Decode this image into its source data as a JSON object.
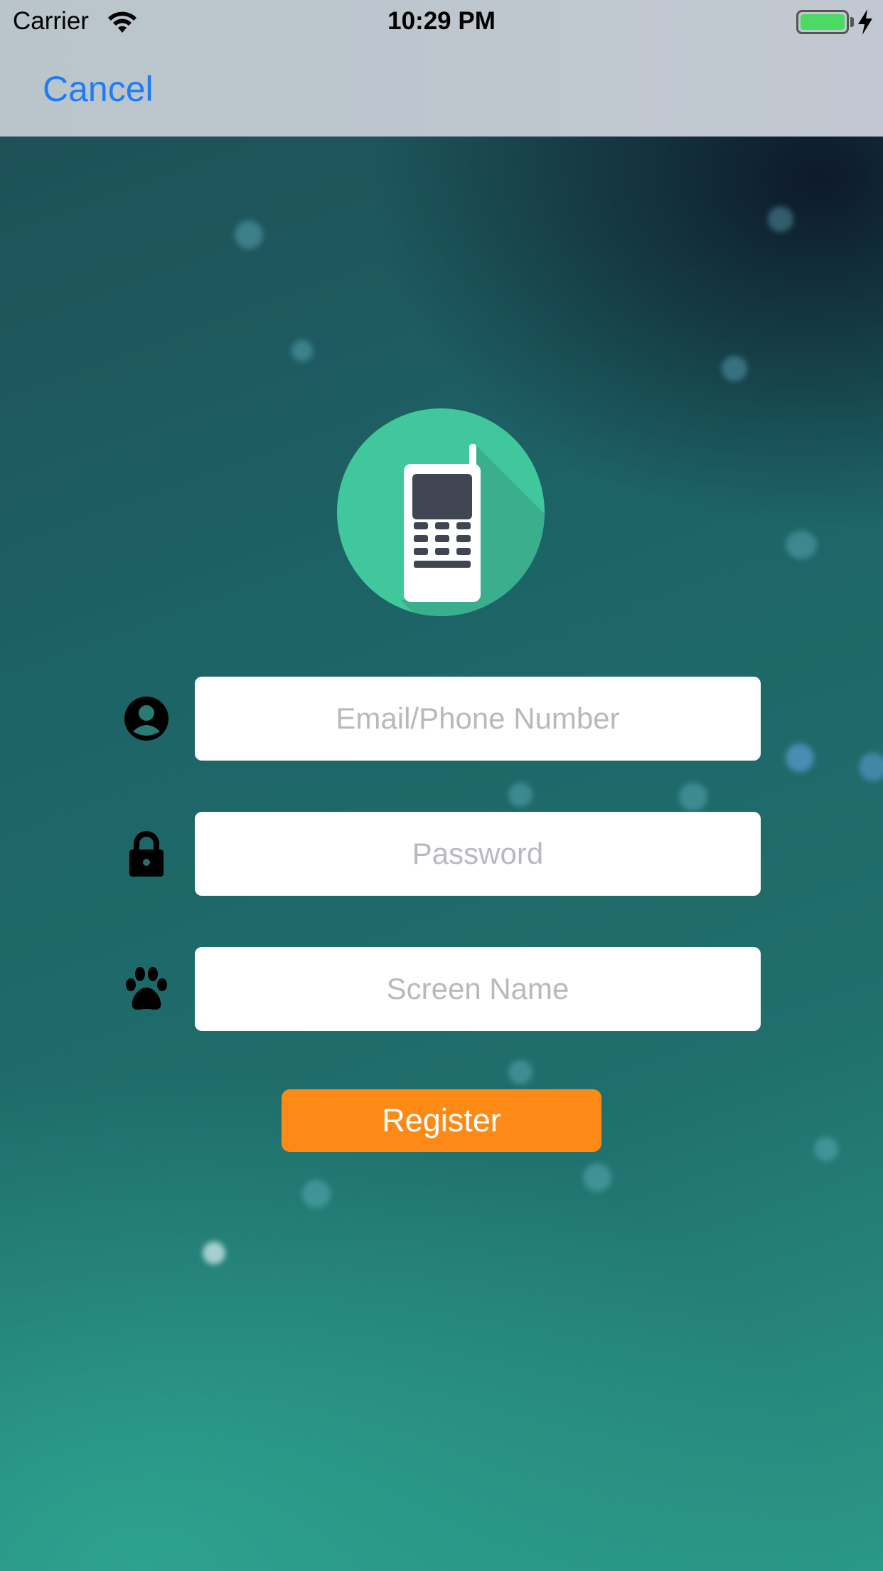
{
  "status_bar": {
    "carrier": "Carrier",
    "time": "10:29 PM",
    "battery_color": "#4cd964"
  },
  "nav": {
    "cancel_label": "Cancel",
    "accent_color": "#1e7cf6"
  },
  "logo": {
    "icon": "mobile-phone-icon",
    "circle_color": "#40c79c"
  },
  "form": {
    "email": {
      "placeholder": "Email/Phone Number",
      "value": "",
      "icon": "user-circle-icon"
    },
    "password": {
      "placeholder": "Password",
      "value": "",
      "icon": "lock-icon"
    },
    "screen_name": {
      "placeholder": "Screen Name",
      "value": "",
      "icon": "paw-icon"
    },
    "register_label": "Register",
    "register_color": "#fd8a17"
  }
}
